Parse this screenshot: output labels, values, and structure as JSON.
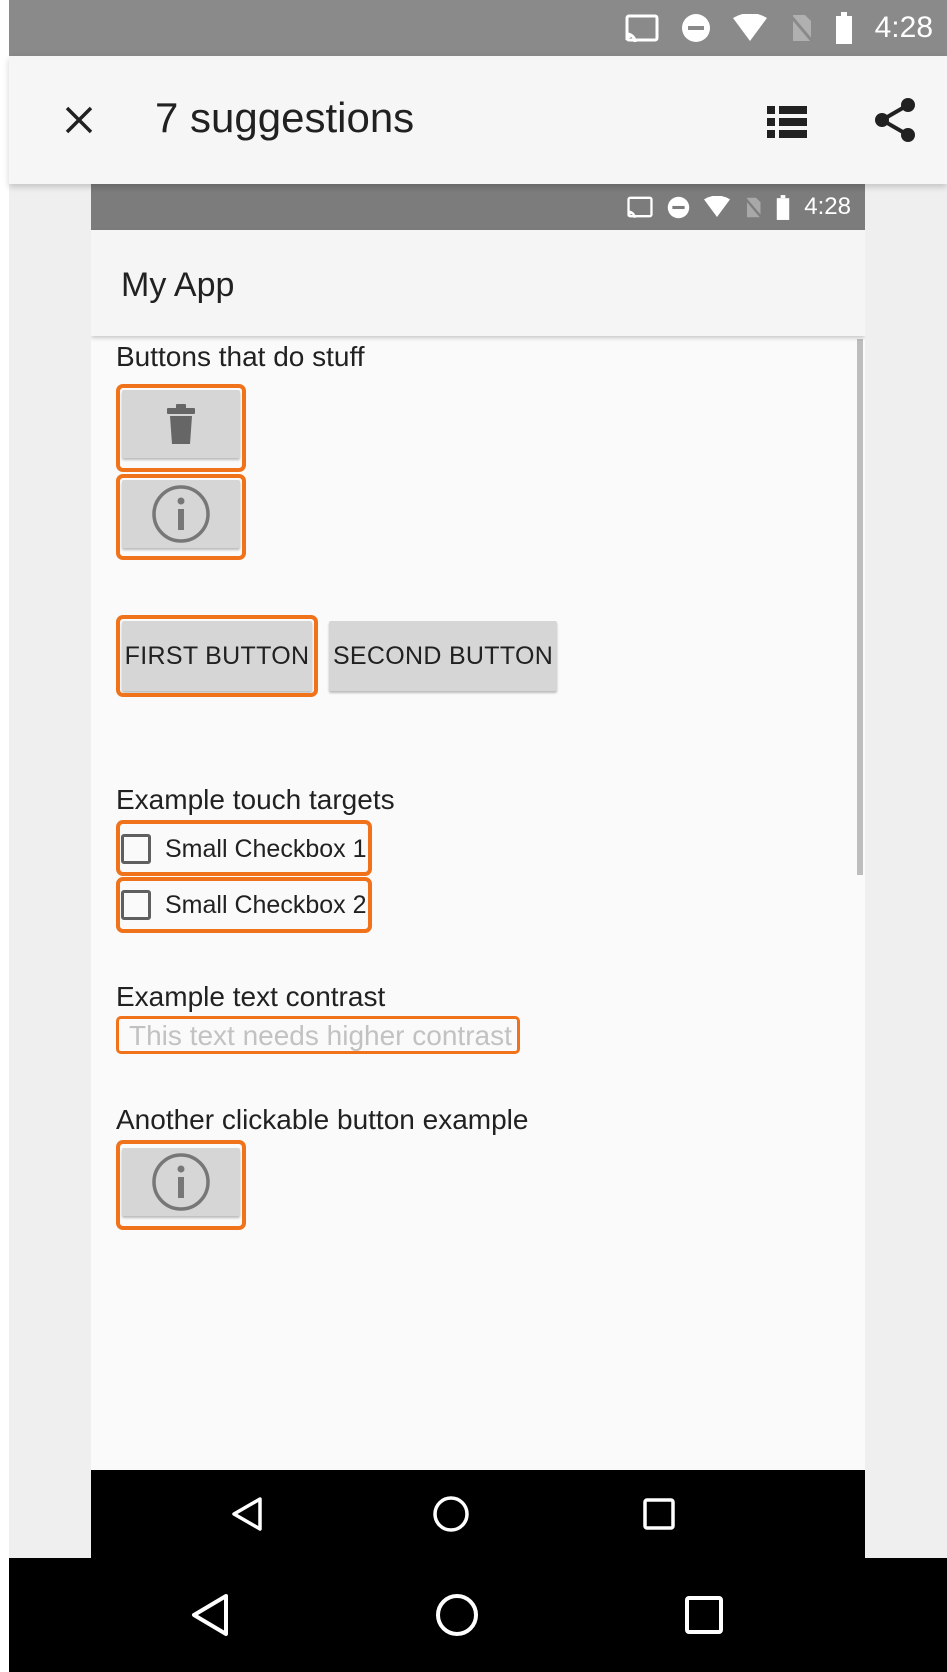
{
  "status_bar": {
    "time": "4:28",
    "icons": [
      "cast-icon",
      "do-not-disturb-icon",
      "wifi-icon",
      "no-sim-icon",
      "battery-icon"
    ]
  },
  "scanner_bar": {
    "title": "7 suggestions",
    "close_icon": "close-icon",
    "list_icon": "list-icon",
    "share_icon": "share-icon"
  },
  "captured_screen": {
    "status_time": "4:28",
    "app_title": "My App",
    "sections": {
      "buttons_label": "Buttons that do stuff",
      "touch_label": "Example touch targets",
      "contrast_label": "Example text contrast",
      "another_label": "Another clickable button example"
    },
    "image_buttons": [
      "delete-icon",
      "info-icon",
      "info-icon"
    ],
    "text_buttons": [
      "FIRST BUTTON",
      "SECOND BUTTON"
    ],
    "checkboxes": [
      "Small Checkbox 1",
      "Small Checkbox 2"
    ],
    "low_contrast_text": "This text needs higher contrast"
  },
  "colors": {
    "highlight": "#f0731c",
    "button_bg": "#d6d6d6",
    "status_bar": "#8a8a8a",
    "low_contrast_text": "#c2c2c2"
  },
  "nav": {
    "icons": [
      "back-icon",
      "home-icon",
      "recents-icon"
    ]
  }
}
